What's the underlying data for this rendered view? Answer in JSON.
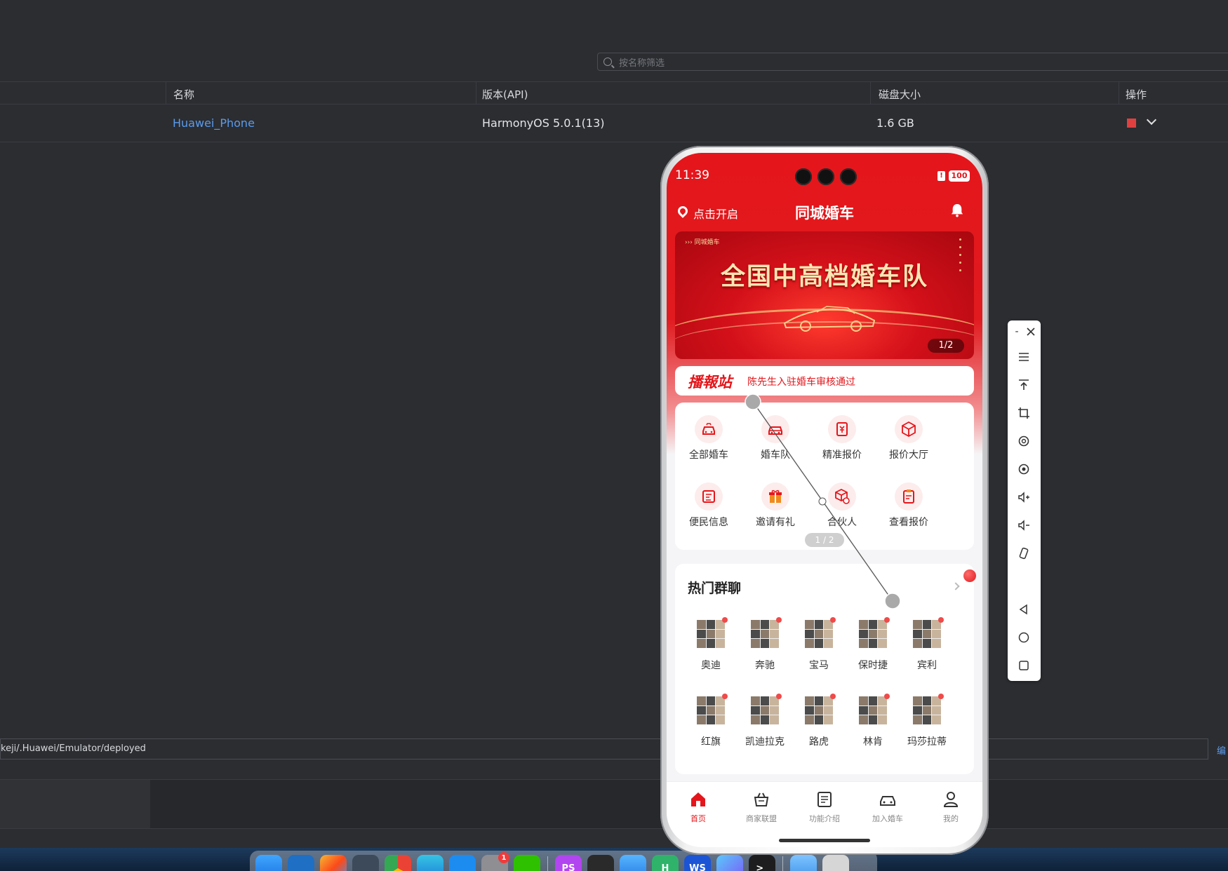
{
  "ide": {
    "search_placeholder": "按名称筛选",
    "table": {
      "headers": [
        "名称",
        "版本(API)",
        "磁盘大小",
        "操作"
      ],
      "row": {
        "name": "Huawei_Phone",
        "version": "HarmonyOS 5.0.1(13)",
        "disk": "1.6 GB"
      }
    },
    "path": "keji/.Huawei/Emulator/deployed",
    "edit_link": "编"
  },
  "phone": {
    "status": {
      "time": "11:39",
      "battery": "100"
    },
    "topbar": {
      "location": "点击开启",
      "title": "同城婚车"
    },
    "banner": {
      "tag": "››› 同城婚车",
      "headline": "全国中高档婚车队",
      "counter": "1/2"
    },
    "broadcast": {
      "logo": "播報站",
      "message": "陈先生入驻婚车审核通过"
    },
    "menu": {
      "items": [
        "全部婚车",
        "婚车队",
        "精准报价",
        "报价大厅",
        "便民信息",
        "邀请有礼",
        "合伙人",
        "查看报价"
      ],
      "page": "1 / 2"
    },
    "hot": {
      "title": "热门群聊",
      "groups": [
        "奥迪",
        "奔驰",
        "宝马",
        "保时捷",
        "宾利",
        "红旗",
        "凯迪拉克",
        "路虎",
        "林肯",
        "玛莎拉蒂"
      ]
    },
    "tabs": [
      "首页",
      "商家联盟",
      "功能介绍",
      "加入婚车",
      "我的"
    ]
  },
  "emulator_toolbar": {
    "minimize": "-"
  },
  "dock": {
    "badge_count": "1",
    "ps_label": "PS",
    "h_label": "H",
    "ws_label": "WS",
    "terminal_prompt": ">_"
  },
  "colors": {
    "brand_red": "#e4161b",
    "link_blue": "#5b9bec"
  }
}
